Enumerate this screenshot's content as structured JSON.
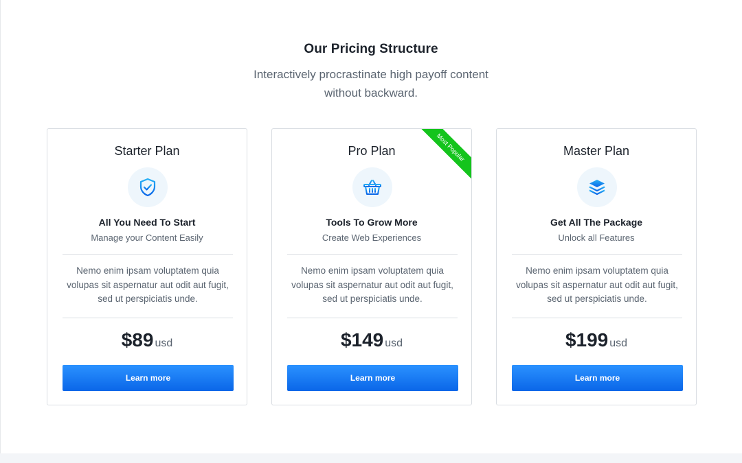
{
  "section": {
    "title": "Our Pricing Structure",
    "subtitle": "Interactively procrastinate high payoff content without backward."
  },
  "plans": [
    {
      "name": "Starter Plan",
      "icon": "shield-check-icon",
      "tagline": "All You Need To Start",
      "tagline_sub": "Manage your Content Easily",
      "description": "Nemo enim ipsam voluptatem quia volupas sit aspernatur aut odit aut fugit, sed ut perspiciatis unde.",
      "price": "$89",
      "unit": "usd",
      "cta": "Learn more"
    },
    {
      "name": "Pro Plan",
      "icon": "basket-icon",
      "tagline": "Tools To Grow More",
      "tagline_sub": "Create Web Experiences",
      "description": "Nemo enim ipsam voluptatem quia volupas sit aspernatur aut odit aut fugit, sed ut perspiciatis unde.",
      "price": "$149",
      "unit": "usd",
      "cta": "Learn more",
      "badge": "Most Popular"
    },
    {
      "name": "Master Plan",
      "icon": "layers-icon",
      "tagline": "Get All The Package",
      "tagline_sub": "Unlock all Features",
      "description": "Nemo enim ipsam voluptatem quia volupas sit aspernatur aut odit aut fugit, sed ut perspiciatis unde.",
      "price": "$199",
      "unit": "usd",
      "cta": "Learn more"
    }
  ],
  "colors": {
    "accent_blue": "#0a66e8",
    "badge_green": "#14c41c",
    "icon_bg": "#eef6fc"
  }
}
